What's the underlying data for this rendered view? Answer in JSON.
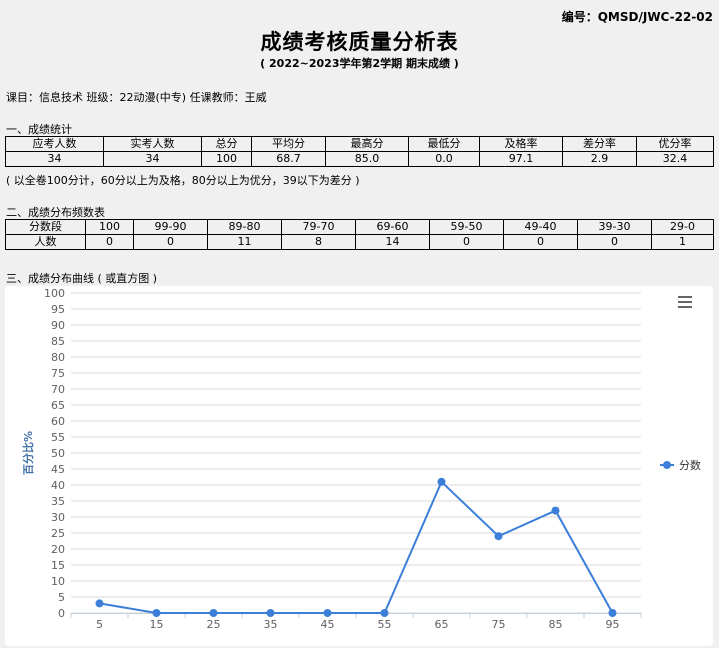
{
  "header": {
    "code": "编号：QMSD/JWC-22-02",
    "title": "成绩考核质量分析表",
    "subtitle": "( 2022~2023学年第2学期  期末成绩 )",
    "info": "课目：信息技术 班级：22动漫(中专) 任课教师：王威"
  },
  "stats": {
    "heading": "一、成绩统计",
    "headers": [
      "应考人数",
      "实考人数",
      "总分",
      "平均分",
      "最高分",
      "最低分",
      "及格率",
      "差分率",
      "优分率"
    ],
    "values": [
      "34",
      "34",
      "100",
      "68.7",
      "85.0",
      "0.0",
      "97.1",
      "2.9",
      "32.4"
    ],
    "note": "( 以全卷100分计，60分以上为及格，80分以上为优分，39以下为差分 )"
  },
  "distribution": {
    "heading": "二、成绩分布频数表",
    "headers": [
      "分数段",
      "100",
      "99-90",
      "89-80",
      "79-70",
      "69-60",
      "59-50",
      "49-40",
      "39-30",
      "29-0"
    ],
    "values": [
      "人数",
      "0",
      "0",
      "11",
      "8",
      "14",
      "0",
      "0",
      "0",
      "1"
    ]
  },
  "chart_section": {
    "heading": "三、成绩分布曲线 ( 或直方图 )"
  },
  "chart_data": {
    "type": "line",
    "title": "",
    "xlabel": "",
    "ylabel": "百分比%",
    "x": [
      5,
      15,
      25,
      35,
      45,
      55,
      65,
      75,
      85,
      95
    ],
    "series": [
      {
        "name": "分数",
        "values": [
          3,
          0,
          0,
          0,
          0,
          0,
          41,
          24,
          32,
          0
        ]
      }
    ],
    "ylim": [
      0,
      100
    ],
    "yticks": [
      0,
      5,
      10,
      15,
      20,
      25,
      30,
      35,
      40,
      45,
      50,
      55,
      60,
      65,
      70,
      75,
      80,
      85,
      90,
      95,
      100
    ],
    "grid": true,
    "legend": "right",
    "color": "#3b7fd9",
    "menu_icon": "menu-icon"
  }
}
